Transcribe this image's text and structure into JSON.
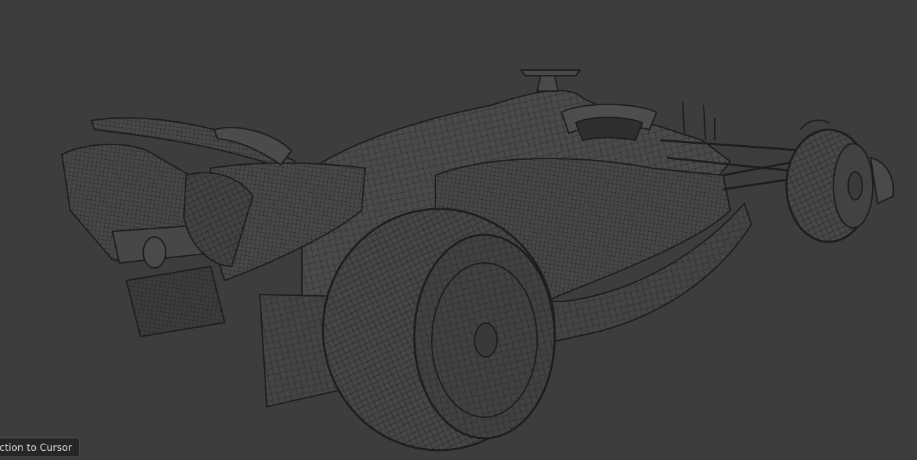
{
  "viewport": {
    "background_color": "#3d3d3d",
    "wire_color": "#1e1e1e",
    "surface_color": "#4a4a4a"
  },
  "model": {
    "name": "wireframe-race-car"
  },
  "status_tooltip": {
    "text": "ction to Cursor"
  }
}
